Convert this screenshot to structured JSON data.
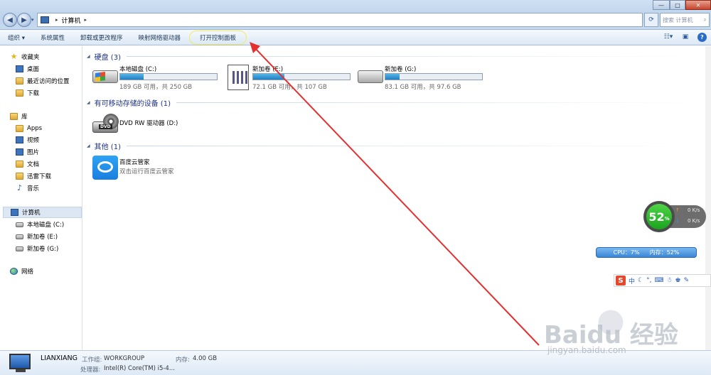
{
  "window": {
    "address_root": "计算机",
    "search_placeholder": "搜索 计算机",
    "controls": {
      "minimize": "—",
      "maximize": "□",
      "close": "✕"
    }
  },
  "toolbar": {
    "items": [
      "组织 ▾",
      "系统属性",
      "卸载或更改程序",
      "映射网络驱动器",
      "打开控制面板"
    ],
    "highlighted_item": "打开控制面板"
  },
  "sidebar": {
    "favorites": {
      "title": "收藏夹",
      "items": [
        "桌面",
        "最近访问的位置",
        "下载"
      ]
    },
    "libraries": {
      "title": "库",
      "items": [
        "Apps",
        "视频",
        "图片",
        "文档",
        "迅雷下载",
        "音乐"
      ]
    },
    "computer": {
      "title": "计算机",
      "items": [
        "本地磁盘 (C:)",
        "新加卷 (E:)",
        "新加卷 (G:)"
      ]
    },
    "network": {
      "title": "网络"
    }
  },
  "main": {
    "groups": {
      "hdd": "硬盘 (3)",
      "removable": "有可移动存储的设备 (1)",
      "other": "其他 (1)"
    },
    "drives": [
      {
        "name": "本地磁盘 (C:)",
        "free": "189 GB 可用，共 250 GB",
        "used_fraction": 0.244,
        "icon": "windows-drive-icon"
      },
      {
        "name": "新加卷 (E:)",
        "free": "72.1 GB 可用，共 107 GB",
        "used_fraction": 0.326,
        "icon": "document-drive-icon"
      },
      {
        "name": "新加卷 (G:)",
        "free": "83.1 GB 可用，共 97.6 GB",
        "used_fraction": 0.149,
        "icon": "hard-drive-icon"
      }
    ],
    "removable": {
      "name": "DVD RW 驱动器 (D:)",
      "badge": "DVD"
    },
    "other": {
      "name": "百度云管家",
      "desc": "双击运行百度云管家"
    }
  },
  "details": {
    "computer_name": "LIANXIANG",
    "workgroup_label": "工作组:",
    "workgroup": "WORKGROUP",
    "memory_label": "内存:",
    "memory": "4.00 GB",
    "cpu_label": "处理器:",
    "cpu": "Intel(R) Core(TM) i5-4..."
  },
  "widgets": {
    "speed_percent": "52",
    "percent_sign": "%",
    "upload": "0 K/s",
    "download": "0 K/s",
    "cpu": "CPU：7%",
    "mem": "内存：52%",
    "ime_s": "S",
    "ime_lang": "中"
  },
  "watermark": {
    "text": "Baidu 经验",
    "url": "jingyan.baidu.com"
  },
  "colors": {
    "accent": "#1e3287",
    "highlight_ring": "#f2ec5c",
    "annotation_arrow": "#e53030",
    "progress": "#1f7fc4"
  }
}
